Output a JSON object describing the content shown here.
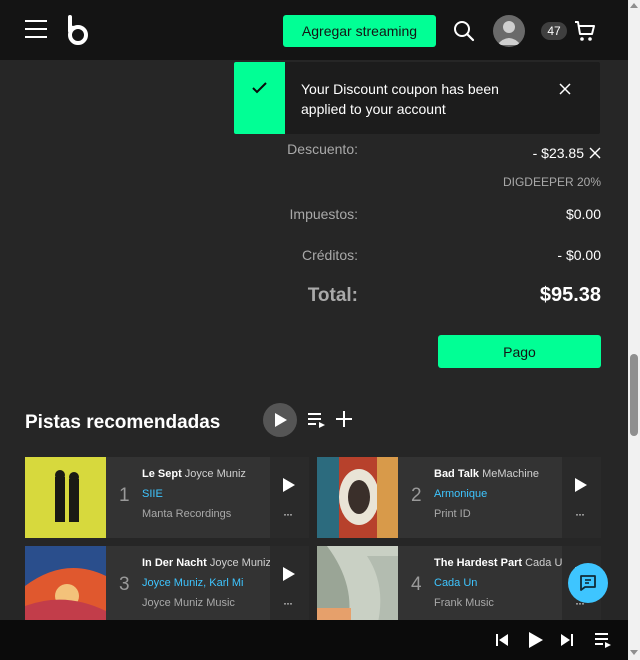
{
  "header": {
    "menu_icon": "hamburger-icon",
    "logo_icon": "beatport-logo-icon",
    "streaming_button": "Agregar streaming",
    "search_icon": "search-icon",
    "avatar_icon": "user-avatar-icon",
    "cart_count": "47",
    "cart_icon": "cart-icon"
  },
  "toast": {
    "message": "Your Discount coupon has been applied to your account",
    "icon": "check-icon",
    "close_icon": "close-icon"
  },
  "summary": {
    "discount_label": "Descuento:",
    "discount_value": "- $23.85",
    "discount_code": "DIGDEEPER 20%",
    "taxes_label": "Impuestos:",
    "taxes_value": "$0.00",
    "credits_label": "Créditos:",
    "credits_value": "- $0.00",
    "total_label": "Total:",
    "total_value": "$95.38",
    "pay_button": "Pago"
  },
  "recommended": {
    "title": "Pistas recomendadas",
    "tracks": [
      {
        "number": "1",
        "title": "Le Sept",
        "artist": "Joyce Muniz",
        "remixer": "SIIE",
        "label": "Manta Recordings"
      },
      {
        "number": "2",
        "title": "Bad Talk",
        "artist": "MeMachine",
        "remixer": "Armonique",
        "label": "Print ID"
      },
      {
        "number": "3",
        "title": "In Der Nacht",
        "artist": "Joyce Muniz",
        "remixer": "Joyce Muniz, Karl Mi",
        "label": "Joyce Muniz Music"
      },
      {
        "number": "4",
        "title": "The Hardest Part",
        "artist": "Cada Un",
        "remixer": "Cada Un",
        "label": "Frank Music"
      }
    ],
    "more_symbol": "···"
  },
  "colors": {
    "accent": "#01ff95",
    "link": "#3ec5ff",
    "background": "#262626",
    "header": "#141414"
  }
}
